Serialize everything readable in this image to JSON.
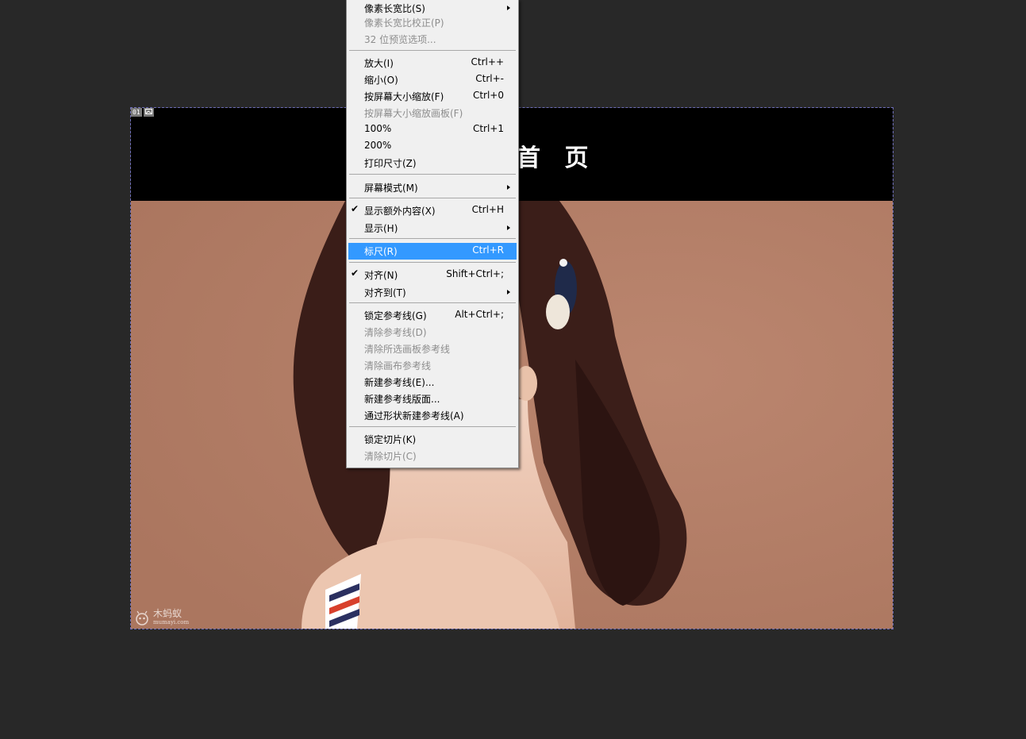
{
  "document": {
    "slice_badge": {
      "number": "01",
      "icon": "image-icon"
    },
    "banner_title": "首 页",
    "watermark": {
      "title": "木蚂蚁",
      "url": "mumayi.com",
      "icon": "ant-logo-icon"
    }
  },
  "menu": {
    "items": [
      {
        "label": "像素长宽比(S)",
        "shortcut": "",
        "submenu": true,
        "disabled": false
      },
      {
        "label": "像素长宽比校正(P)",
        "shortcut": "",
        "disabled": true
      },
      {
        "label": "32 位预览选项...",
        "shortcut": "",
        "disabled": true
      },
      {
        "label": "放大(I)",
        "shortcut": "Ctrl++"
      },
      {
        "label": "缩小(O)",
        "shortcut": "Ctrl+-"
      },
      {
        "label": "按屏幕大小缩放(F)",
        "shortcut": "Ctrl+0"
      },
      {
        "label": "按屏幕大小缩放画板(F)",
        "shortcut": "",
        "disabled": true
      },
      {
        "label": "100%",
        "shortcut": "Ctrl+1"
      },
      {
        "label": "200%",
        "shortcut": ""
      },
      {
        "label": "打印尺寸(Z)",
        "shortcut": ""
      },
      {
        "label": "屏幕模式(M)",
        "shortcut": "",
        "submenu": true
      },
      {
        "label": "显示额外内容(X)",
        "shortcut": "Ctrl+H",
        "checked": true
      },
      {
        "label": "显示(H)",
        "shortcut": "",
        "submenu": true
      },
      {
        "label": "标尺(R)",
        "shortcut": "Ctrl+R",
        "highlighted": true
      },
      {
        "label": "对齐(N)",
        "shortcut": "Shift+Ctrl+;",
        "checked": true
      },
      {
        "label": "对齐到(T)",
        "shortcut": "",
        "submenu": true
      },
      {
        "label": "锁定参考线(G)",
        "shortcut": "Alt+Ctrl+;"
      },
      {
        "label": "清除参考线(D)",
        "shortcut": "",
        "disabled": true
      },
      {
        "label": "清除所选画板参考线",
        "shortcut": "",
        "disabled": true
      },
      {
        "label": "清除画布参考线",
        "shortcut": "",
        "disabled": true
      },
      {
        "label": "新建参考线(E)...",
        "shortcut": ""
      },
      {
        "label": "新建参考线版面...",
        "shortcut": ""
      },
      {
        "label": "通过形状新建参考线(A)",
        "shortcut": ""
      },
      {
        "label": "锁定切片(K)",
        "shortcut": ""
      },
      {
        "label": "清除切片(C)",
        "shortcut": "",
        "disabled": true
      }
    ],
    "check_glyph": "✔"
  }
}
